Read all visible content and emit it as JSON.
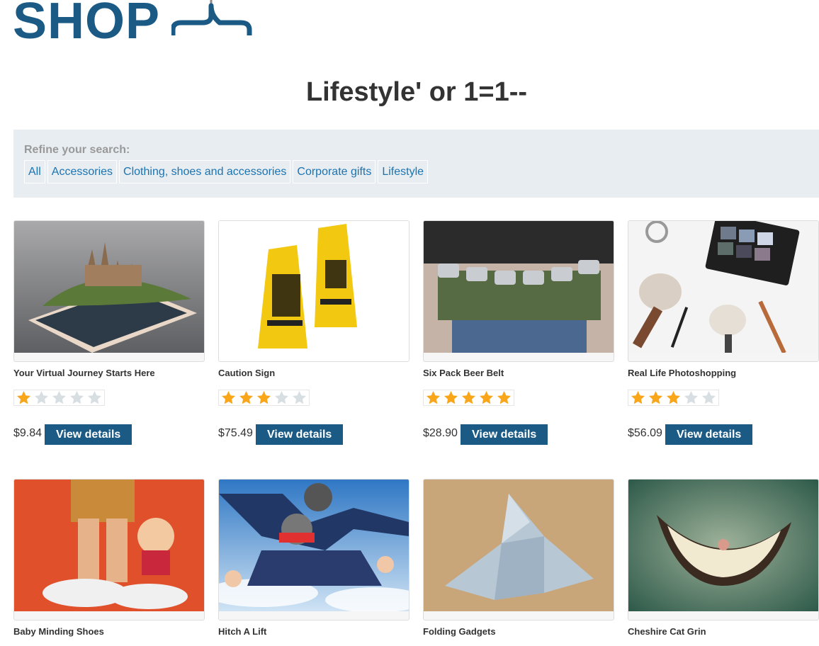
{
  "header": {
    "logo_text": "SHOP",
    "logo_icon": "coat-hanger-icon",
    "brand_color": "#1a5a85"
  },
  "page_title": "Lifestyle' or 1=1--",
  "filter": {
    "label": "Refine your search:",
    "links": [
      "All",
      "Accessories",
      "Clothing, shoes and accessories",
      "Corporate gifts",
      "Lifestyle"
    ]
  },
  "products": [
    {
      "name": "Your Virtual Journey Starts Here",
      "rating": 1,
      "price": "$9.84",
      "button": "View details",
      "image": "castle-on-phone"
    },
    {
      "name": "Caution Sign",
      "rating": 3,
      "price": "$75.49",
      "button": "View details",
      "image": "caution-signs"
    },
    {
      "name": "Six Pack Beer Belt",
      "rating": 5,
      "price": "$28.90",
      "button": "View details",
      "image": "beer-belt"
    },
    {
      "name": "Real Life Photoshopping",
      "rating": 3,
      "price": "$56.09",
      "button": "View details",
      "image": "makeup-brushes"
    },
    {
      "name": "Baby Minding Shoes",
      "image": "baby-shoes"
    },
    {
      "name": "Hitch A Lift",
      "image": "skydivers"
    },
    {
      "name": "Folding Gadgets",
      "image": "origami-bird"
    },
    {
      "name": "Cheshire Cat Grin",
      "image": "cat-grin"
    }
  ],
  "colors": {
    "star_filled": "#f9a61b",
    "star_empty": "#d8dfe3",
    "link": "#1b74b2",
    "panel_bg": "#e8edf1"
  }
}
